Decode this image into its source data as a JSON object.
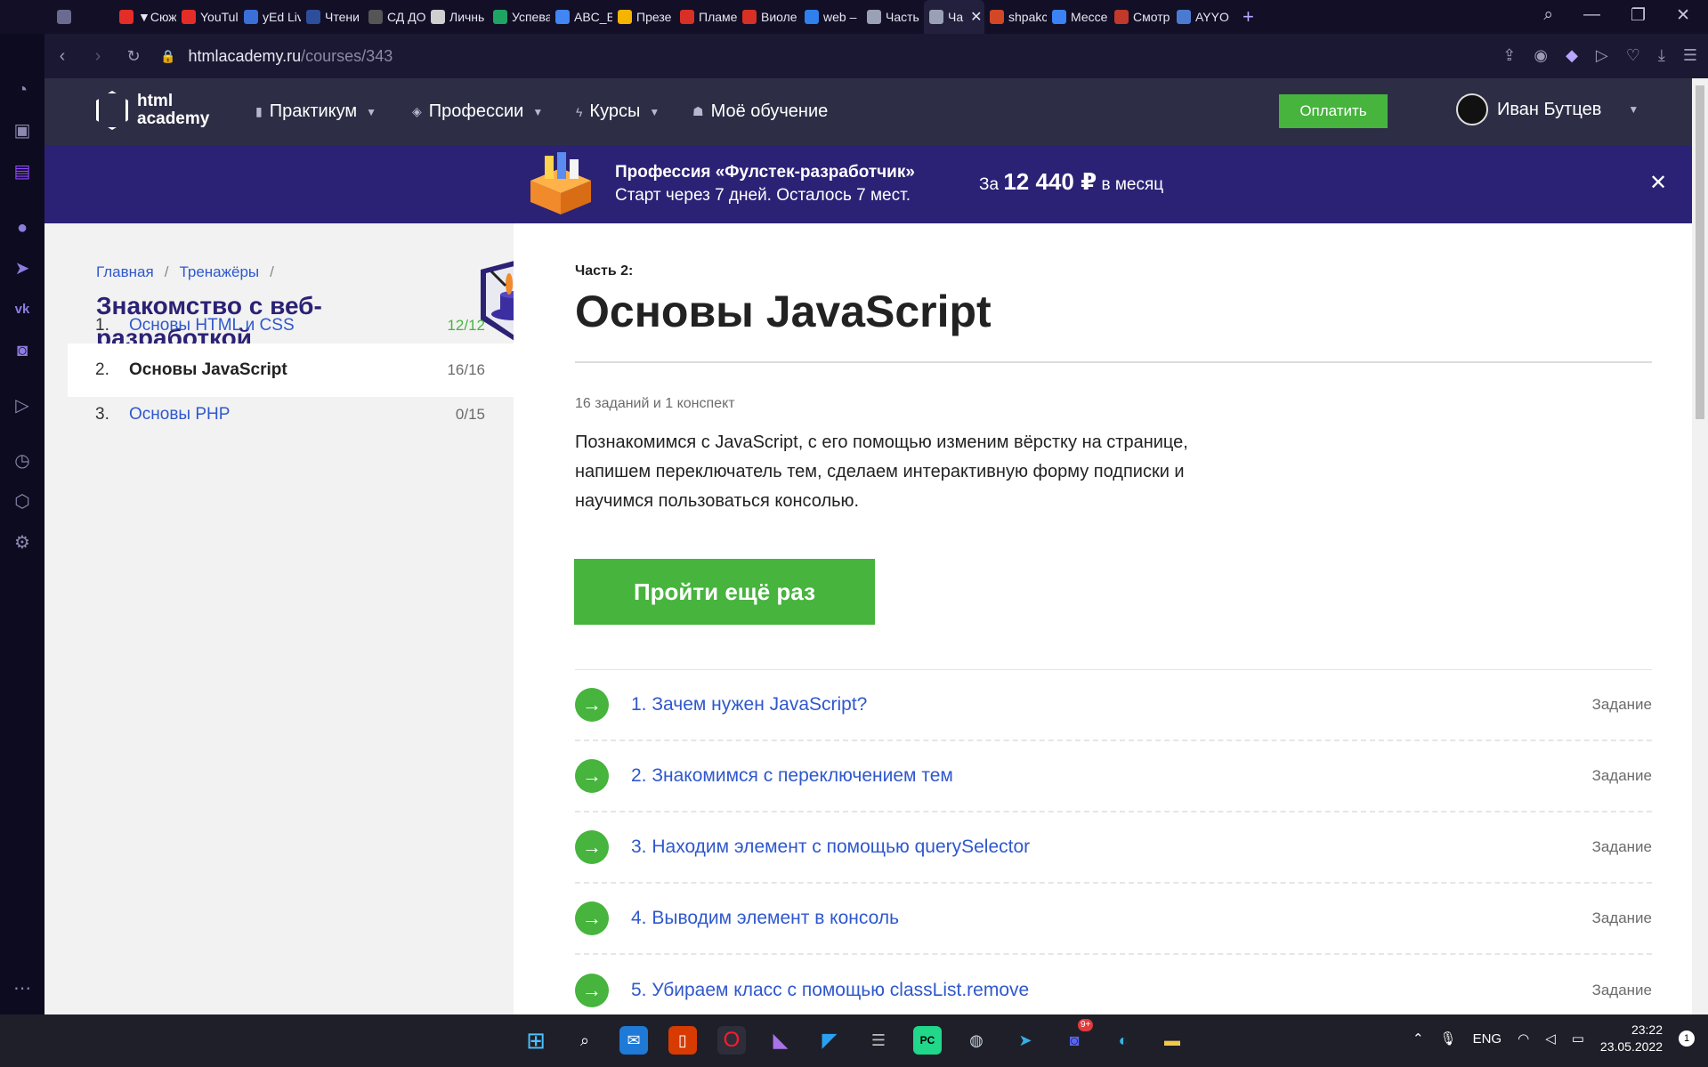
{
  "browser": {
    "tabs": [
      {
        "label": "",
        "color": "#6b6b8f"
      },
      {
        "label": "▼Сюж",
        "color": "#e52d27"
      },
      {
        "label": "YouTul",
        "color": "#e52d27"
      },
      {
        "label": "yEd Liv",
        "color": "#3a6fd8"
      },
      {
        "label": "Чтени",
        "color": "#2d4e9a"
      },
      {
        "label": "СД ДО.СК",
        "color": "#555"
      },
      {
        "label": "Личнь",
        "color": "#cfcfcf"
      },
      {
        "label": "Успева",
        "color": "#1fa463"
      },
      {
        "label": "ABC_Б",
        "color": "#4285f4"
      },
      {
        "label": "Презе",
        "color": "#f4b400"
      },
      {
        "label": "Пламе",
        "color": "#d93025"
      },
      {
        "label": "Виоле",
        "color": "#d93025"
      },
      {
        "label": "web –",
        "color": "#2f80ed"
      },
      {
        "label": "Часть",
        "color": "#9aa0b5"
      },
      {
        "label": "Ча",
        "color": "#9aa0b5",
        "active": true
      },
      {
        "label": "shpakc",
        "color": "#d24726"
      },
      {
        "label": "Мессе",
        "color": "#3b82f6"
      },
      {
        "label": "Смотр",
        "color": "#c0392b"
      },
      {
        "label": "AYYO",
        "color": "#4a7bd0"
      }
    ],
    "url_host": "htmlacademy.ru",
    "url_path": "/courses/343"
  },
  "header": {
    "logo_line1": "html",
    "logo_line2": "academy",
    "nav": [
      "Практикум",
      "Профессии",
      "Курсы",
      "Моё обучение"
    ],
    "pay_label": "Оплатить",
    "user_name": "Иван Бутцев"
  },
  "promo": {
    "title": "Профессия «Фулстек-разработчик»",
    "subtitle": "Старт через 7 дней. Осталось 7 мест.",
    "price_prefix": "За",
    "price": "12 440 ₽",
    "price_suffix": "в месяц",
    "close": "✕"
  },
  "left": {
    "breadcrumb": [
      "Главная",
      "Тренажёры"
    ],
    "course_title": "Знакомство с веб-разработкой",
    "lessons": [
      {
        "num": "1.",
        "label": "Основы HTML и CSS",
        "count": "12/12",
        "count_color": "#46b43d"
      },
      {
        "num": "2.",
        "label": "Основы JavaScript",
        "count": "16/16",
        "count_color": "#6b6b6b"
      },
      {
        "num": "3.",
        "label": "Основы PHP",
        "count": "0/15",
        "count_color": "#6b6b6b"
      }
    ]
  },
  "main": {
    "part": "Часть 2:",
    "title": "Основы JavaScript",
    "meta": "16 заданий и 1 конспект",
    "description": "Познакомимся с JavaScript, с его помощью изменим вёрстку на странице, напишем переключатель тем, сделаем интерактивную форму подписки и научимся пользоваться консолью.",
    "retry_label": "Пройти ещё раз",
    "tasks": [
      {
        "label": "1. Зачем нужен JavaScript?",
        "kind": "Задание"
      },
      {
        "label": "2. Знакомимся с переключением тем",
        "kind": "Задание"
      },
      {
        "label": "3. Находим элемент с помощью querySelector",
        "kind": "Задание"
      },
      {
        "label": "4. Выводим элемент в консоль",
        "kind": "Задание"
      },
      {
        "label": "5. Убираем класс с помощью classList.remove",
        "kind": "Задание"
      }
    ]
  },
  "taskbar": {
    "lang": "ENG",
    "time": "23:22",
    "date": "23.05.2022",
    "notif_count": "1",
    "discord_badge": "9+"
  }
}
